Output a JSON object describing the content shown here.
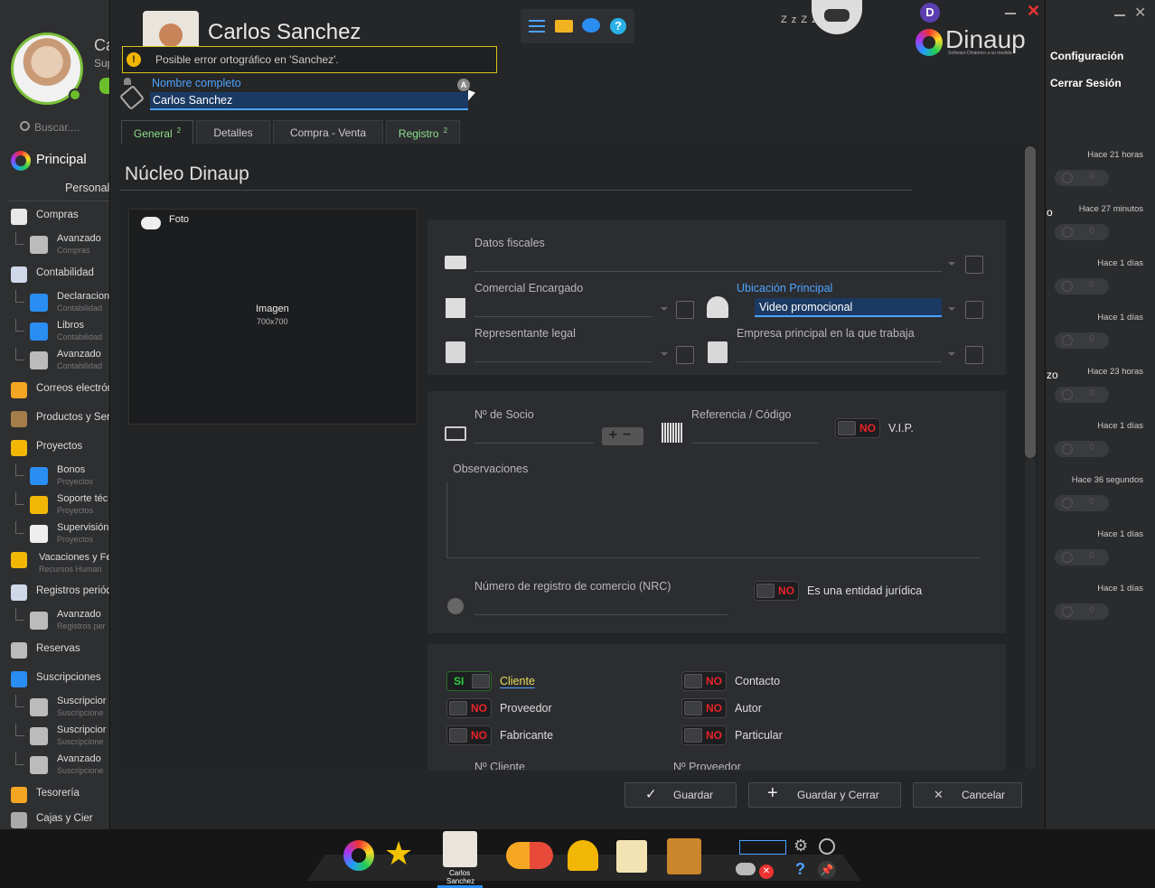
{
  "left_app": {
    "user_initial_text": "Ca",
    "user_sub_text": "Sup",
    "search_placeholder": "Buscar....",
    "principal": "Principal",
    "personal": "Personal",
    "nav": [
      {
        "label": "Compras"
      },
      {
        "label": "Avanzado",
        "sub": "Compras"
      },
      {
        "label": "Contabilidad"
      },
      {
        "label": "Declaracion",
        "sub": "Contabilidad"
      },
      {
        "label": "Libros",
        "sub": "Contabilidad"
      },
      {
        "label": "Avanzado",
        "sub": "Contabilidad"
      },
      {
        "label": "Correos electrón"
      },
      {
        "label": "Productos y Ser"
      },
      {
        "label": "Proyectos"
      },
      {
        "label": "Bonos",
        "sub": "Proyectos"
      },
      {
        "label": "Soporte téc",
        "sub": "Proyectos"
      },
      {
        "label": "Supervisión",
        "sub": "Proyectos"
      },
      {
        "label": "Vacaciones y Fe",
        "sub": "Recursos Human"
      },
      {
        "label": "Registros periód"
      },
      {
        "label": "Avanzado",
        "sub": "Registros per"
      },
      {
        "label": "Reservas"
      },
      {
        "label": "Suscripciones"
      },
      {
        "label": "Suscripcior",
        "sub": "Suscripcione"
      },
      {
        "label": "Suscripcior",
        "sub": "Suscripcione"
      },
      {
        "label": "Avanzado",
        "sub": "Suscripcione"
      },
      {
        "label": "Tesorería"
      },
      {
        "label": "Cajas y Cier"
      }
    ]
  },
  "right_app": {
    "menu": [
      "Configuración",
      "Cerrar Sesión"
    ],
    "fragments": [
      "o",
      "zo"
    ],
    "notifications": [
      "Hace 21 horas",
      "Hace 27 minutos",
      "Hace 1 días",
      "Hace 1 días",
      "Hace 23 horas",
      "Hace 1 días",
      "Hace 36 segundos",
      "Hace 1 días",
      "Hace 1 días"
    ],
    "pill_value": "0"
  },
  "window": {
    "title": "Carlos Sanchez",
    "brand": "Dinaup",
    "brand_tagline": "Software Dinámico a su medida",
    "avatar_letter": "D",
    "sleep_text": "Z z Z z",
    "spell_warning": "Posible error ortográfico en 'Sanchez'.",
    "name_label": "Nombre completo",
    "name_value": "Carlos Sanchez",
    "name_badge": "A"
  },
  "tabs": [
    {
      "label": "General",
      "badge": "2",
      "active": true
    },
    {
      "label": "Detalles",
      "badge": ""
    },
    {
      "label": "Compra - Venta",
      "badge": ""
    },
    {
      "label": "Registro",
      "badge": "2"
    }
  ],
  "section_title": "Núcleo Dinaup",
  "photo": {
    "label": "Foto",
    "placeholder": "Imagen",
    "size": "700x700"
  },
  "fields": {
    "datos_fiscales": "Datos fiscales",
    "comercial": "Comercial Encargado",
    "ubicacion_label": "Ubicación Principal",
    "ubicacion_value": "Video promocional",
    "representante": "Representante legal",
    "empresa": "Empresa principal en la que trabaja",
    "socio": "Nº de Socio",
    "referencia": "Referencia / Código",
    "vip": "V.I.P.",
    "vip_value": "NO",
    "observaciones": "Observaciones",
    "nrc": "Número de registro de comercio (NRC)",
    "juridica": "Es una entidad jurídica",
    "juridica_value": "NO",
    "num_cliente": "Nº Cliente",
    "num_proveedor": "Nº Proveedor"
  },
  "roles": [
    {
      "label": "Cliente",
      "value": "SI"
    },
    {
      "label": "Contacto",
      "value": "NO"
    },
    {
      "label": "Proveedor",
      "value": "NO"
    },
    {
      "label": "Autor",
      "value": "NO"
    },
    {
      "label": "Fabricante",
      "value": "NO"
    },
    {
      "label": "Particular",
      "value": "NO"
    }
  ],
  "buttons": {
    "guardar": "Guardar",
    "guardar_cerrar": "Guardar y Cerrar",
    "cancelar": "Cancelar"
  },
  "taskbar": {
    "active_label_1": "Carlos",
    "active_label_2": "Sanchez"
  },
  "colors": {
    "accent_blue": "#4da3ff",
    "yes_green": "#2ecc40",
    "no_red": "#e8232a",
    "warn_yellow": "#d9c21a"
  }
}
